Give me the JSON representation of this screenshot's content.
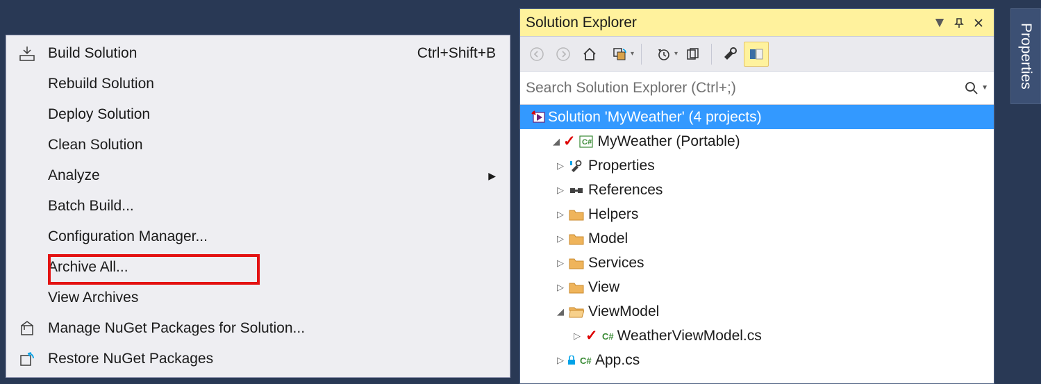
{
  "menu": {
    "items": [
      {
        "label": "Build Solution",
        "shortcut": "Ctrl+Shift+B",
        "icon": "build"
      },
      {
        "label": "Rebuild Solution"
      },
      {
        "label": "Deploy Solution"
      },
      {
        "label": "Clean Solution"
      },
      {
        "label": "Analyze",
        "arrow": true
      },
      {
        "label": "Batch Build..."
      },
      {
        "label": "Configuration Manager...",
        "highlighted": true
      },
      {
        "label": "Archive All..."
      },
      {
        "label": "View Archives"
      },
      {
        "label": "Manage NuGet Packages for Solution...",
        "icon": "nuget"
      },
      {
        "label": "Restore NuGet Packages",
        "icon": "restore"
      }
    ]
  },
  "solutionExplorer": {
    "title": "Solution Explorer",
    "searchPlaceholder": "Search Solution Explorer (Ctrl+;)",
    "solutionLabel": "Solution 'MyWeather' (4 projects)",
    "project": "MyWeather (Portable)",
    "nodes": {
      "properties": "Properties",
      "references": "References",
      "helpers": "Helpers",
      "model": "Model",
      "services": "Services",
      "view": "View",
      "viewmodel": "ViewModel",
      "weathervm": "WeatherViewModel.cs",
      "appcs": "App.cs"
    }
  },
  "sideTab": "Properties"
}
